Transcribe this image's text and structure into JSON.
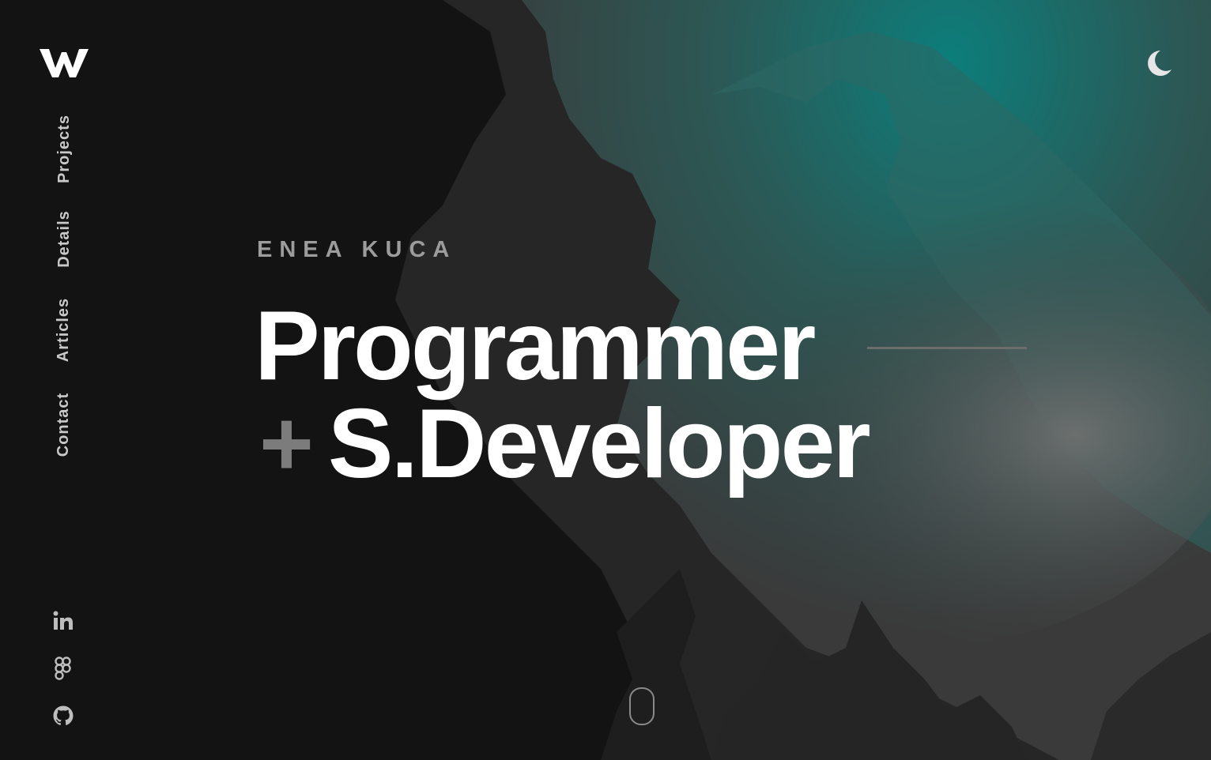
{
  "logo": {
    "icon": "w-logo-icon",
    "color": "#ffffff"
  },
  "theme_toggle": {
    "icon": "moon-icon",
    "color": "#e6e6e6"
  },
  "nav": {
    "items": [
      {
        "label": "Projects"
      },
      {
        "label": "Details"
      },
      {
        "label": "Articles"
      },
      {
        "label": "Contact"
      }
    ]
  },
  "socials": {
    "items": [
      {
        "icon": "linkedin-icon"
      },
      {
        "icon": "figma-icon"
      },
      {
        "icon": "github-icon"
      }
    ]
  },
  "hero": {
    "name": "ENEA KUCA",
    "line1": "Programmer",
    "plus": "+",
    "line2": "S.Developer"
  },
  "scroll_indicator": {
    "icon": "mouse-scroll-icon"
  },
  "colors": {
    "background": "#131313",
    "accent_teal": "#127a78",
    "text_primary": "#ffffff",
    "text_muted": "#9c9c9c"
  }
}
